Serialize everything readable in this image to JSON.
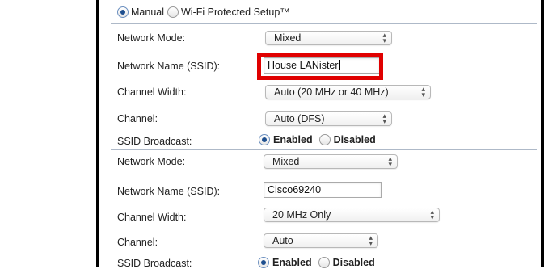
{
  "mode_options": {
    "manual": "Manual",
    "wps": "Wi-Fi Protected Setup™",
    "selected": "manual"
  },
  "labels": {
    "network_mode": "Network Mode:",
    "network_name": "Network Name (SSID):",
    "channel_width": "Channel Width:",
    "channel": "Channel:",
    "ssid_broadcast": "SSID Broadcast:"
  },
  "broadcast_options": {
    "enabled": "Enabled",
    "disabled": "Disabled"
  },
  "band1": {
    "network_mode": "Mixed",
    "ssid": "House LANister",
    "channel_width": "Auto (20 MHz or 40 MHz)",
    "channel": "Auto (DFS)",
    "ssid_broadcast": "enabled"
  },
  "band2": {
    "network_mode": "Mixed",
    "ssid": "Cisco69240",
    "channel_width": "20 MHz Only",
    "channel": "Auto",
    "ssid_broadcast": "enabled"
  },
  "colors": {
    "highlight": "#e00000",
    "radio_selected": "#1e4f8f",
    "separator": "#aeb9c8"
  }
}
